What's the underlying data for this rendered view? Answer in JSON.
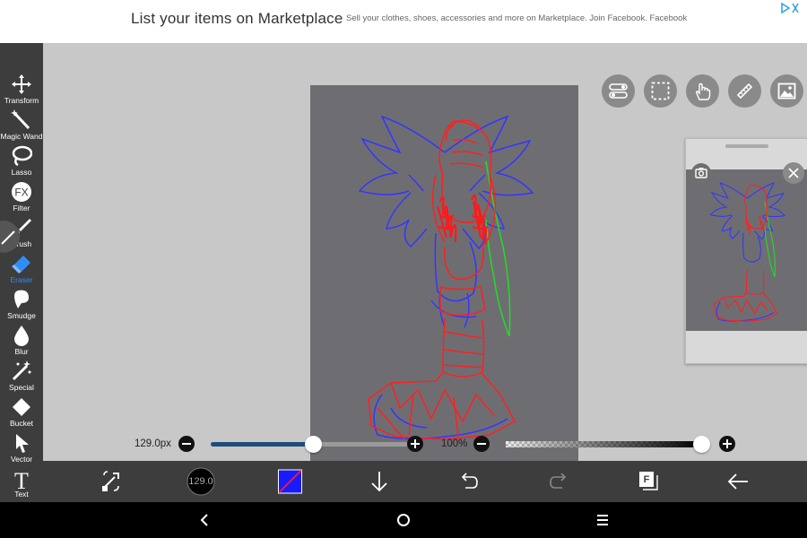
{
  "ad": {
    "title": "List your items on Marketplace",
    "subtitle": "Sell your clothes, shoes, accessories and more on Marketplace. Join Facebook. Facebook"
  },
  "tools": [
    {
      "label": "Transform",
      "icon": "transform-icon"
    },
    {
      "label": "Magic Wand",
      "icon": "magic-wand-icon"
    },
    {
      "label": "Lasso",
      "icon": "lasso-icon"
    },
    {
      "label": "Filter",
      "icon": "fx-icon"
    },
    {
      "label": "Brush",
      "icon": "brush-icon"
    },
    {
      "label": "Eraser",
      "icon": "eraser-icon",
      "active": true
    },
    {
      "label": "Smudge",
      "icon": "smudge-icon"
    },
    {
      "label": "Blur",
      "icon": "blur-icon"
    },
    {
      "label": "Special",
      "icon": "special-icon"
    },
    {
      "label": "Bucket",
      "icon": "bucket-icon"
    },
    {
      "label": "Vector",
      "icon": "vector-icon"
    },
    {
      "label": "Text",
      "icon": "text-icon"
    }
  ],
  "filter_glyph": "FX",
  "text_glyph": "T",
  "brush_size": {
    "label": "129.0px",
    "value_fraction": 0.5
  },
  "opacity": {
    "label": "100%",
    "value_fraction": 1.0
  },
  "bottom": {
    "brush_size_badge": "129.0",
    "layer_badge": "F"
  },
  "colors": {
    "accent": "#2f8ef5",
    "toolbar_bg": "#3d3d3d",
    "canvas_bg": "#6e6e72",
    "primary_color_fill": "#1a1aff",
    "primary_color_slash": "#ff2020"
  }
}
